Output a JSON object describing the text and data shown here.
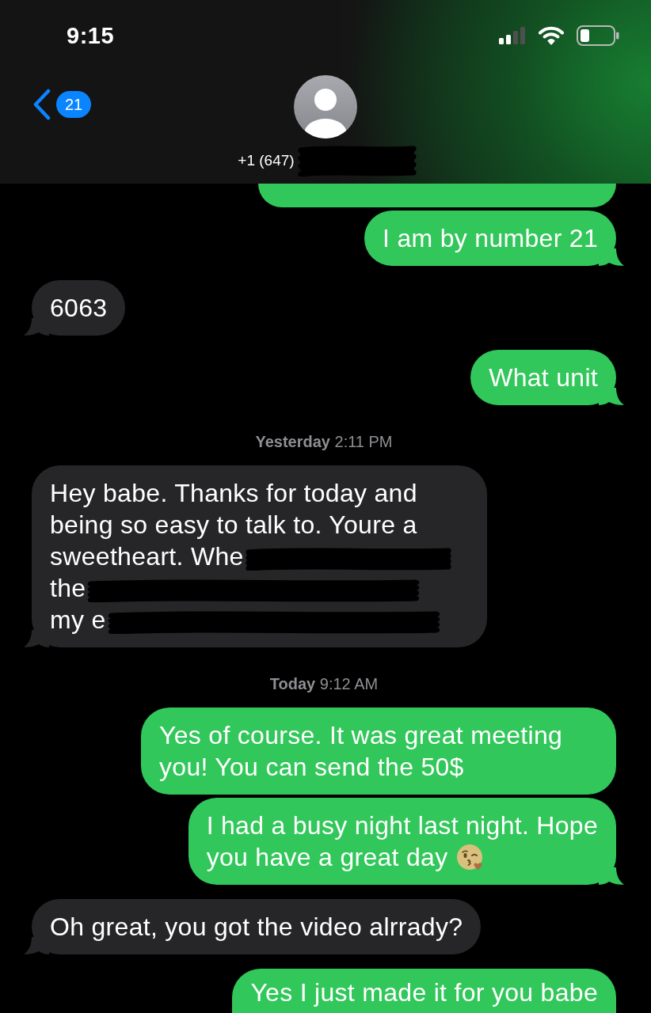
{
  "status_bar": {
    "time": "9:15"
  },
  "navigation": {
    "back_badge": "21",
    "contact": {
      "name": "+1 (647)",
      "redacted": true
    }
  },
  "thread": [
    {
      "kind": "sent",
      "tail": false
    },
    {
      "kind": "sent",
      "text": "I am by number 21",
      "tail": true
    },
    {
      "kind": "received",
      "text": "6063",
      "tail": true
    },
    {
      "kind": "sent",
      "text": "What unit",
      "tail": true
    },
    {
      "kind": "timestamp",
      "text": "**Yesterday** 2:11 PM"
    },
    {
      "kind": "received",
      "tail": true,
      "segments": [
        {
          "text": "Hey babe. Thanks for today and being so easy to talk to. Youre a",
          "redacted": false
        },
        {
          "text": "sweetheart. Whe",
          "redacted": true
        },
        {
          "text": "the",
          "redacted": true
        },
        {
          "text": "my e",
          "redacted": true
        }
      ]
    },
    {
      "kind": "timestamp",
      "text": "**Today** 9:12 AM"
    },
    {
      "kind": "sent",
      "text": "Yes of course. It was great meeting you! You can send the 50$",
      "tail": false
    },
    {
      "kind": "sent",
      "tail": true,
      "segments": [
        {
          "text": "I had a busy night last night. Hope",
          "emoji": false
        },
        {
          "text": "you have a great day",
          "emoji": true
        }
      ]
    },
    {
      "kind": "received",
      "text": "Oh great, you got the video alrrady?",
      "tail": true
    },
    {
      "kind": "sent",
      "text": "Yes I just made it for you babe",
      "tail": false
    }
  ]
}
